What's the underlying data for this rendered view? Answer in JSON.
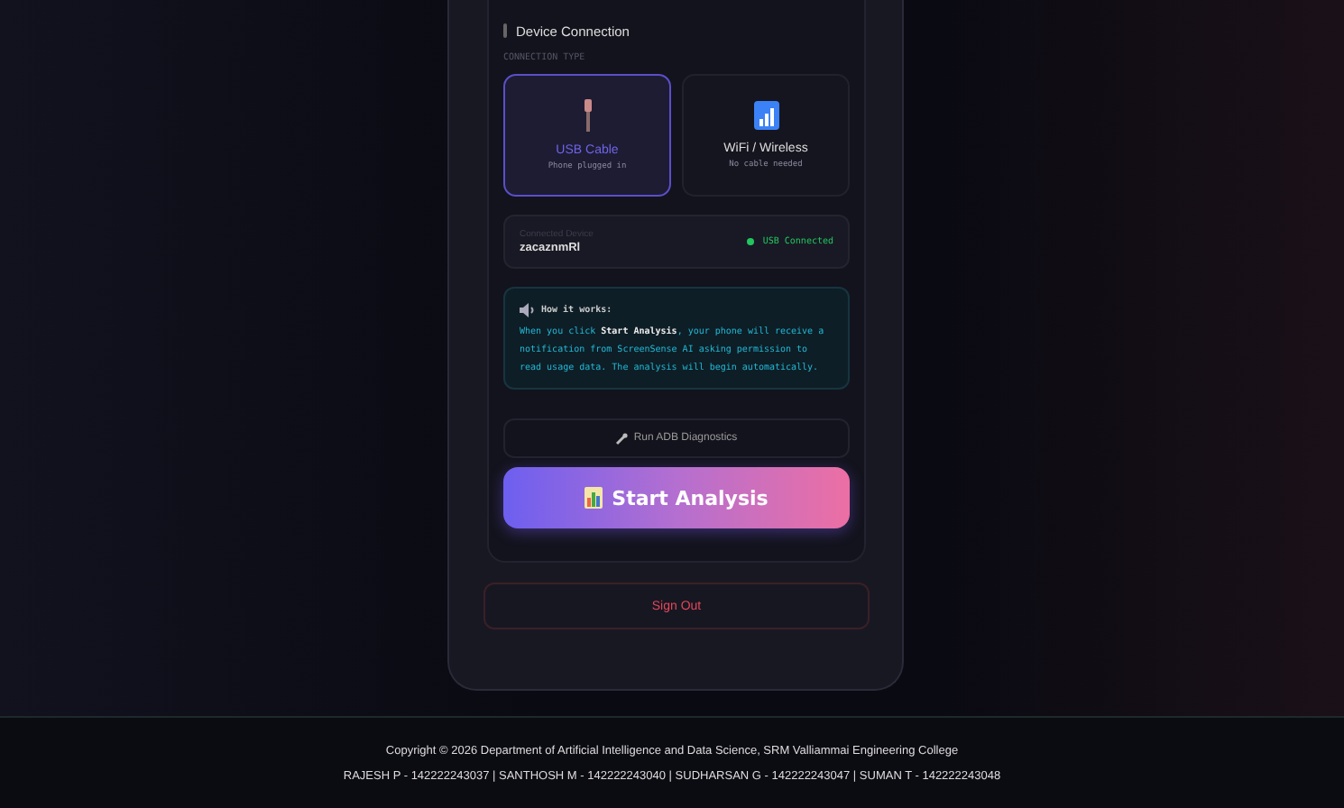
{
  "section": {
    "title": "Device Connection",
    "type_label": "CONNECTION TYPE"
  },
  "connection_types": [
    {
      "kind": "usb",
      "label": "USB Cable",
      "hint": "Phone plugged in",
      "selected": true
    },
    {
      "kind": "wifi",
      "label": "WiFi / Wireless",
      "hint": "No cable needed",
      "selected": false
    }
  ],
  "device": {
    "label": "Connected Device",
    "name": "zacaznmRl",
    "status": "USB Connected",
    "connected": true
  },
  "info": {
    "title": "How it works:",
    "text": "When you click **Start Analysis**, your phone will receive a notification from ScreenSense AI asking permission to read usage data. The analysis will begin automatically."
  },
  "buttons": {
    "diagnostics": "Run ADB Diagnostics",
    "start": "Start Analysis",
    "sign_out": "Sign Out"
  },
  "footer": {
    "copyright": "Copyright © 2026 Department of Artificial Intelligence and Data Science, SRM Valliammai Engineering College",
    "members": "RAJESH P - 142222243037 | SANTHOSH M - 142222243040 | SUDHARSAN G - 142222243047 | SUMAN T - 142222243048"
  }
}
